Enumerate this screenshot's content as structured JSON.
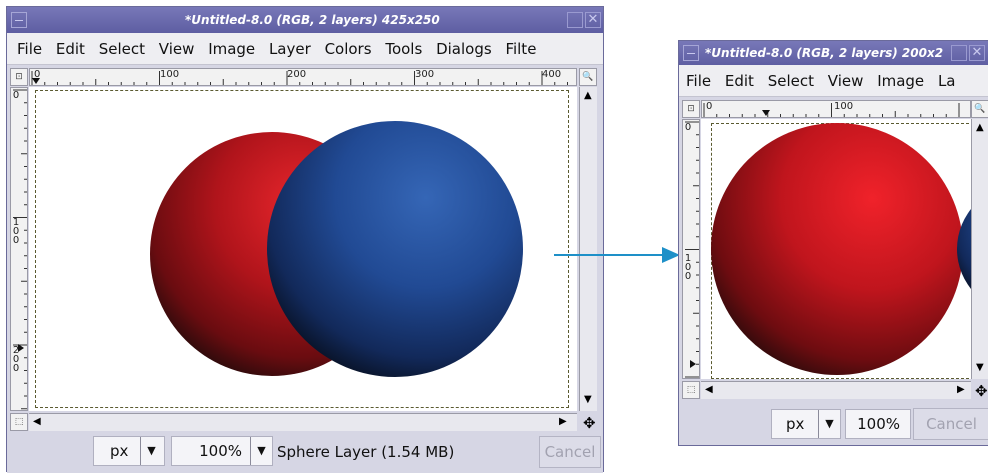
{
  "window_large": {
    "title": "*Untitled-8.0 (RGB, 2 layers) 425x250",
    "menu": [
      "File",
      "Edit",
      "Select",
      "View",
      "Image",
      "Layer",
      "Colors",
      "Tools",
      "Dialogs",
      "Filte"
    ],
    "ruler_h": [
      "0",
      "100",
      "200",
      "300",
      "400"
    ],
    "ruler_v": [
      "0",
      "100",
      "200"
    ],
    "unit": "px",
    "zoom": "100%",
    "status": "Sphere Layer (1.54 MB)",
    "cancel": "Cancel"
  },
  "window_small": {
    "title": "*Untitled-8.0 (RGB, 2 layers) 200x2",
    "menu": [
      "File",
      "Edit",
      "Select",
      "View",
      "Image",
      "La"
    ],
    "ruler_h": [
      "0",
      "100"
    ],
    "ruler_v": [
      "0",
      "100"
    ],
    "unit": "px",
    "zoom": "100%",
    "cancel": "Cancel"
  },
  "colors": {
    "titlebar": "#6666aa",
    "window_bg": "#d6d6e4",
    "sphere_red": "#d21820",
    "sphere_blue": "#2a56a8",
    "arrow": "#1e90c8"
  },
  "icons": [
    "navigate-icon",
    "zoom-icon",
    "quickmask-icon",
    "move-cross-icon",
    "dropdown-arrow-icon",
    "scroll-arrow-icon"
  ]
}
